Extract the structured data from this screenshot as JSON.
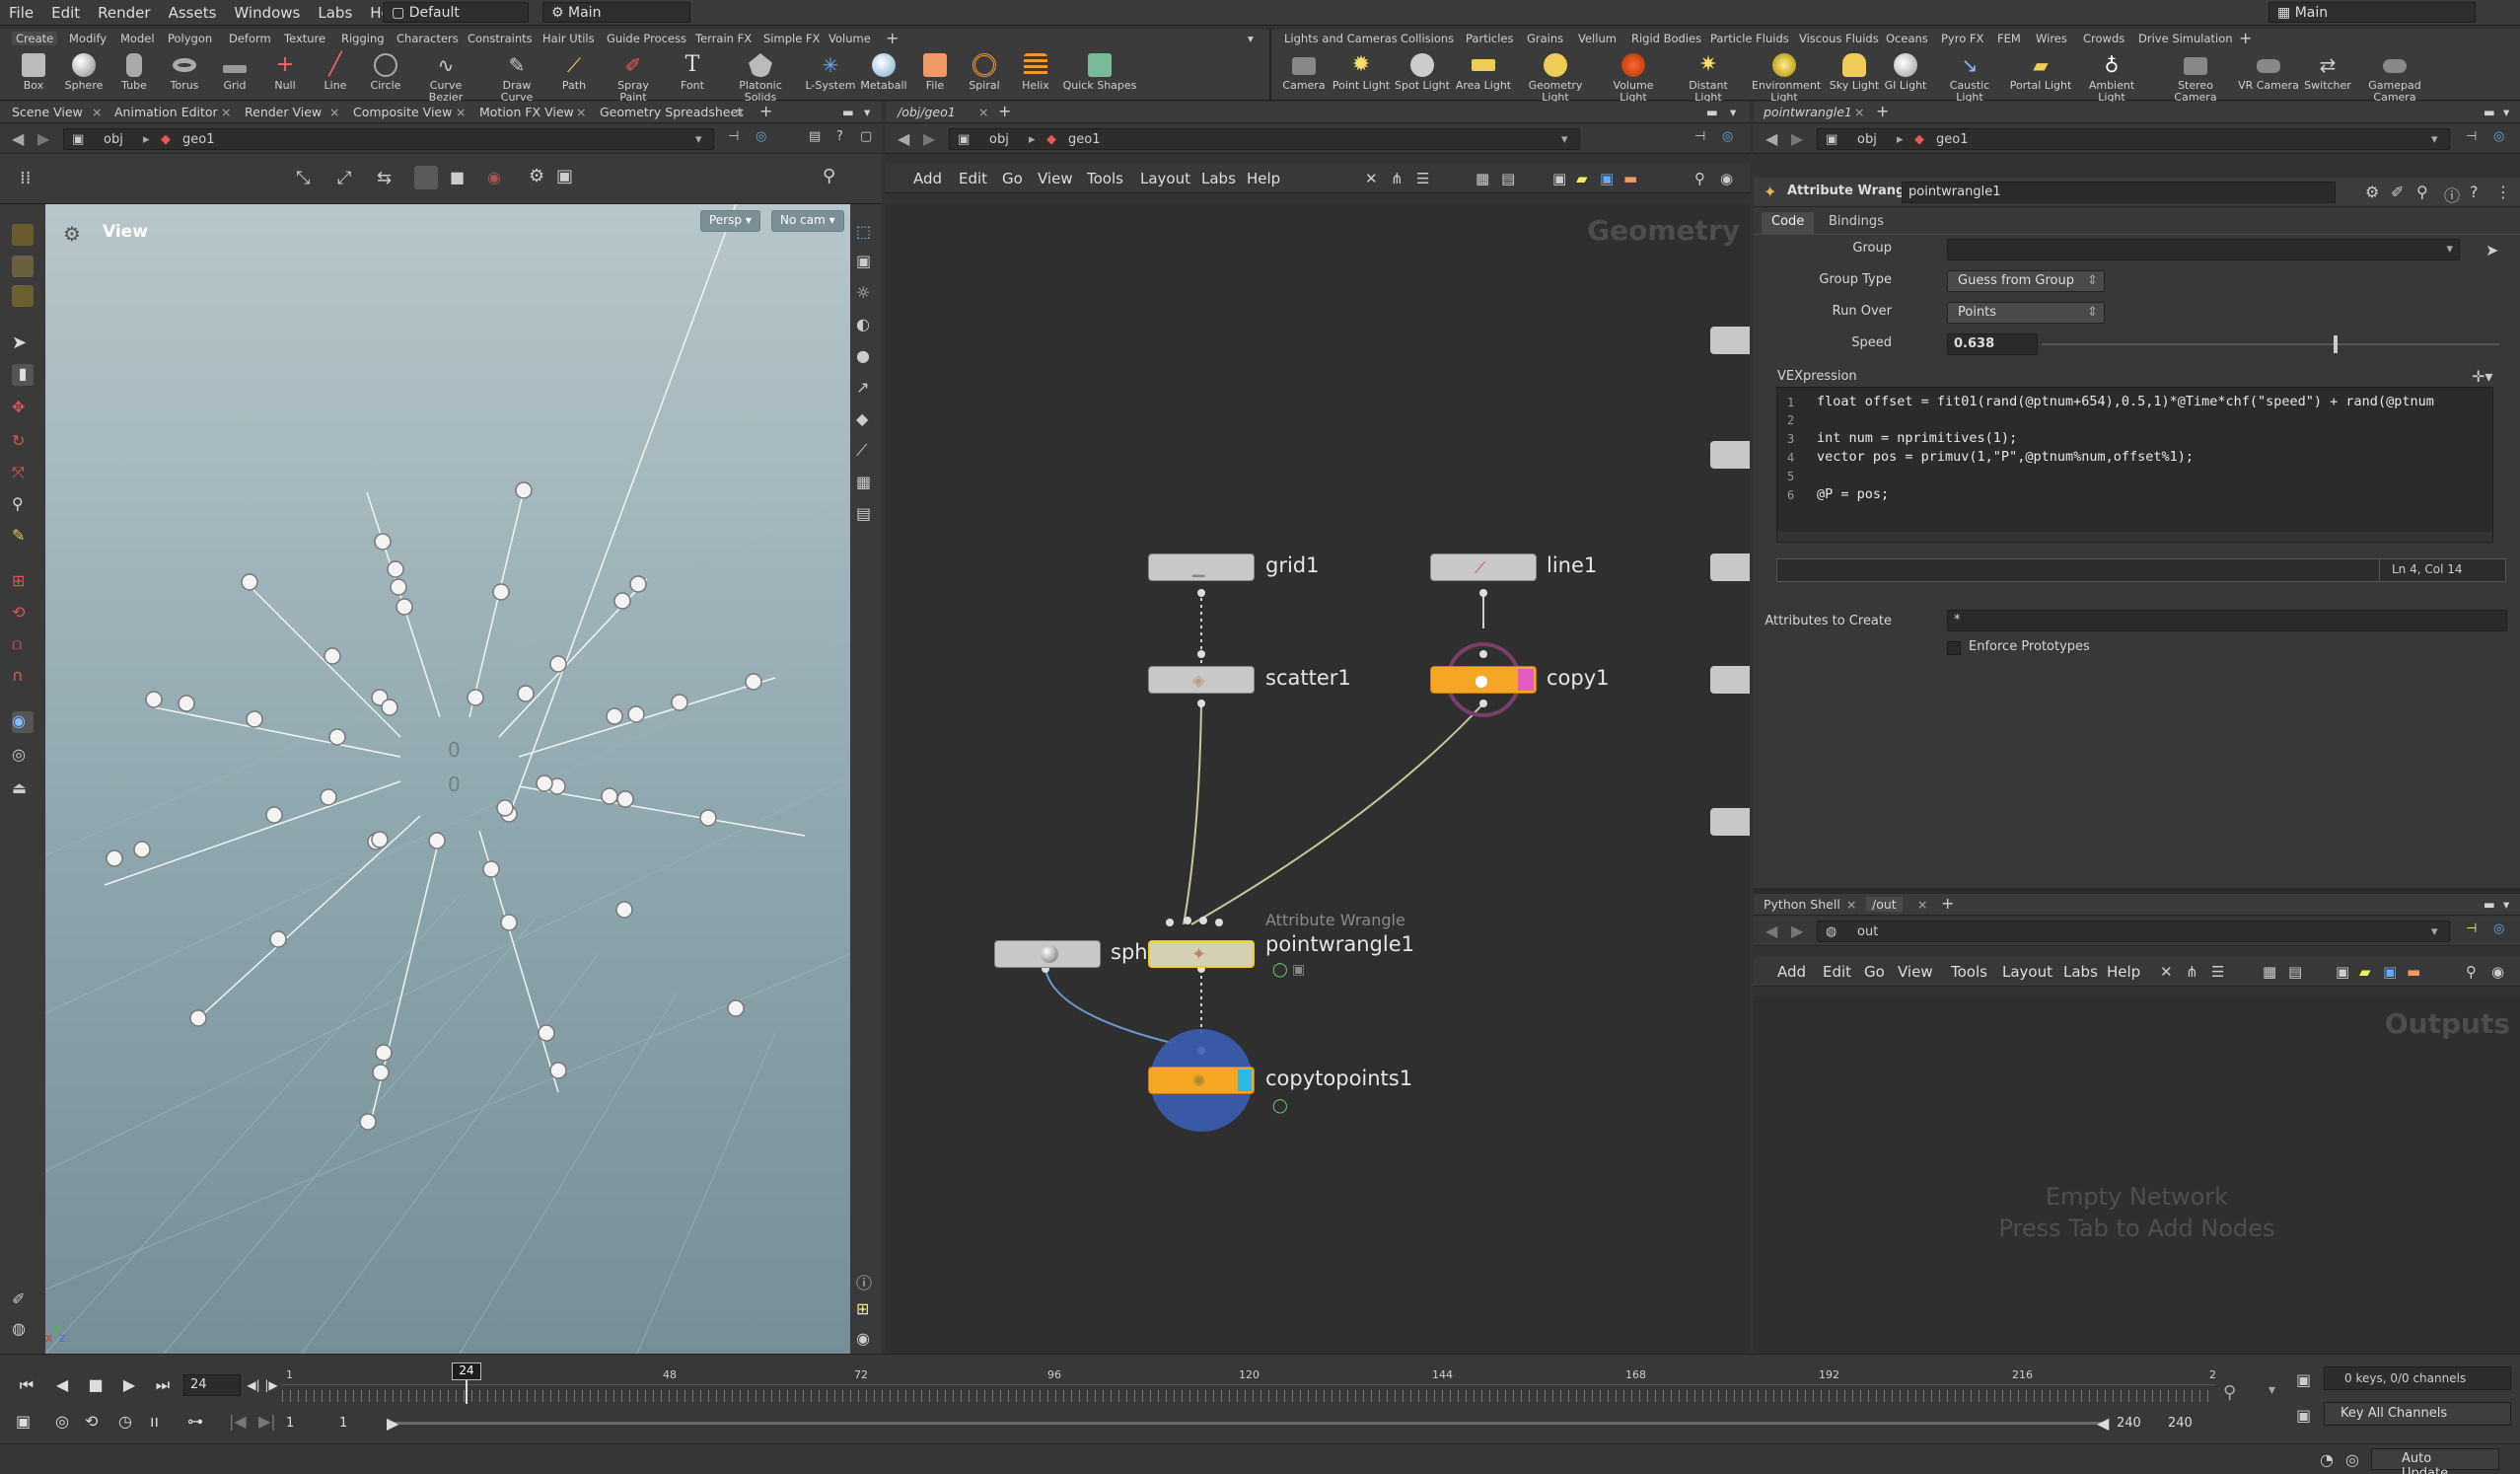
{
  "menubar": {
    "items": [
      "File",
      "Edit",
      "Render",
      "Assets",
      "Windows",
      "Labs",
      "Help"
    ],
    "desktop": "Default",
    "context": "Main",
    "right_context": "Main"
  },
  "shelf": {
    "tabs_left": [
      "Create",
      "Modify",
      "Model",
      "Polygon",
      "Deform",
      "Texture",
      "Rigging",
      "Characters",
      "Constraints",
      "Hair Utils",
      "Guide Process",
      "Terrain FX",
      "Simple FX",
      "Volume"
    ],
    "tabs_right": [
      "Lights and Cameras",
      "Collisions",
      "Particles",
      "Grains",
      "Vellum",
      "Rigid Bodies",
      "Particle Fluids",
      "Viscous Fluids",
      "Oceans",
      "Pyro FX",
      "FEM",
      "Wires",
      "Crowds",
      "Drive Simulation"
    ],
    "tools_left": [
      "Box",
      "Sphere",
      "Tube",
      "Torus",
      "Grid",
      "Null",
      "Line",
      "Circle",
      "Curve Bezier",
      "Draw Curve",
      "Path",
      "Spray Paint",
      "Font",
      "Platonic Solids",
      "L-System",
      "Metaball",
      "File",
      "Spiral",
      "Helix",
      "Quick Shapes"
    ],
    "tools_right": [
      "Camera",
      "Point Light",
      "Spot Light",
      "Area Light",
      "Geometry Light",
      "Volume Light",
      "Distant Light",
      "Environment Light",
      "Sky Light",
      "GI Light",
      "Caustic Light",
      "Portal Light",
      "Ambient Light",
      "Stereo Camera",
      "VR Camera",
      "Switcher",
      "Gamepad Camera"
    ]
  },
  "left_pane": {
    "tabs": [
      "Scene View",
      "Animation Editor",
      "Render View",
      "Composite View",
      "Motion FX View",
      "Geometry Spreadsheet"
    ],
    "path": [
      "obj",
      "geo1"
    ],
    "view_label": "View",
    "persp": "Persp",
    "cam": "No cam"
  },
  "mid_pane": {
    "tab": "/obj/geo1",
    "path": [
      "obj",
      "geo1"
    ],
    "menus": [
      "Add",
      "Edit",
      "Go",
      "View",
      "Tools",
      "Layout",
      "Labs",
      "Help"
    ],
    "context_label": "Geometry",
    "nodes": {
      "grid": "grid1",
      "line": "line1",
      "scatter": "scatter1",
      "copy": "copy1",
      "sphere": "sph",
      "wrangle_type": "Attribute Wrangle",
      "wrangle": "pointwrangle1",
      "copytopoints": "copytopoints1"
    }
  },
  "parms": {
    "tab": "pointwrangle1",
    "path": [
      "obj",
      "geo1"
    ],
    "node_type": "Attribute Wrangle",
    "node_name": "pointwrangle1",
    "subtabs": [
      "Code",
      "Bindings"
    ],
    "group_label": "Group",
    "group_value": "",
    "group_type_label": "Group Type",
    "group_type_value": "Guess from Group",
    "run_over_label": "Run Over",
    "run_over_value": "Points",
    "speed_label": "Speed",
    "speed_value": "0.638",
    "speed_fraction": 0.638,
    "vex_label": "VEXpression",
    "code_lines": [
      "float offset = fit01(rand(@ptnum+654),0.5,1)*@Time*chf(\"speed\") + rand(@ptnum",
      "",
      "int num = nprimitives(1);",
      "vector pos = primuv(1,\"P\",@ptnum%num,offset%1);",
      "",
      "@P = pos;"
    ],
    "cursor_pos": "Ln 4, Col 14",
    "attr_label": "Attributes to Create",
    "attr_value": "*",
    "enforce_label": "Enforce Prototypes"
  },
  "out_pane": {
    "tabs": [
      "Python Shell",
      "/out"
    ],
    "path": "out",
    "menus": [
      "Add",
      "Edit",
      "Go",
      "View",
      "Tools",
      "Layout",
      "Labs",
      "Help"
    ],
    "context_label": "Outputs",
    "empty1": "Empty Network",
    "empty2": "Press Tab to Add Nodes"
  },
  "timeline": {
    "current_frame": "24",
    "marker": "24",
    "ticks": [
      "1",
      "24",
      "48",
      "72",
      "96",
      "120",
      "144",
      "168",
      "192",
      "216",
      "2"
    ],
    "start": "1",
    "start2": "1",
    "end": "240",
    "end2": "240",
    "keys": "0 keys, 0/0 channels",
    "key_all": "Key All Channels",
    "auto_update": "Auto Update"
  }
}
